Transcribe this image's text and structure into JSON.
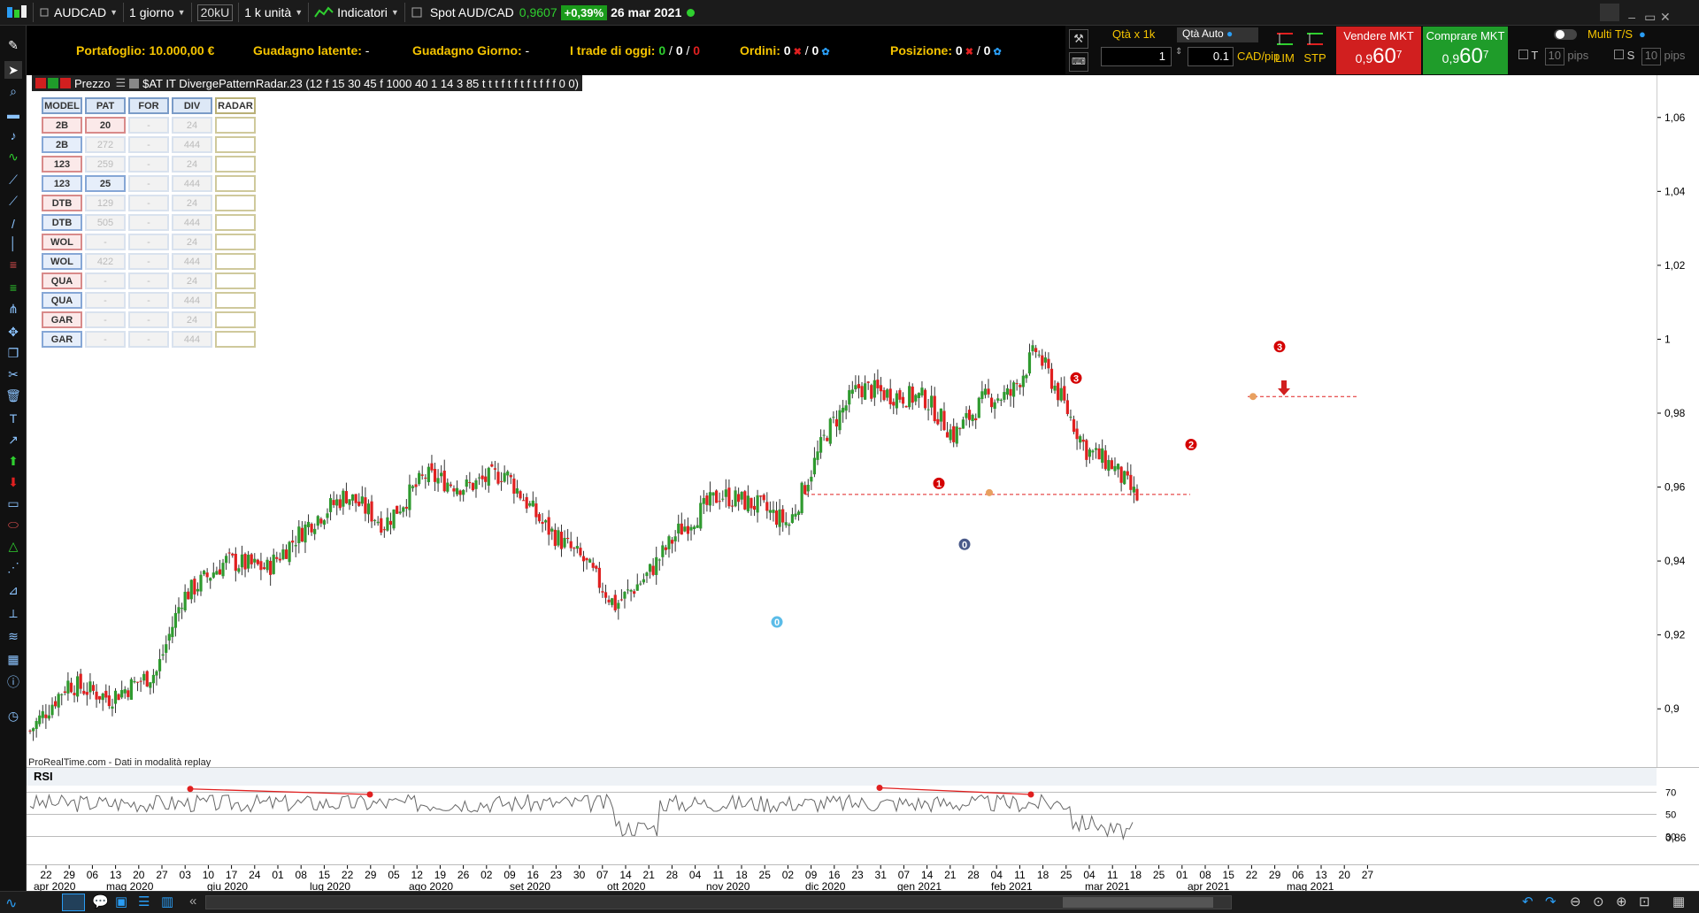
{
  "topbar": {
    "symbol": "AUDCAD",
    "timeframe": "1 giorno",
    "units_box": "20kU",
    "units": "1 k unità",
    "indicators": "Indicatori",
    "instrument": "Spot AUD/CAD",
    "last_price": "0,9607",
    "change": "+0,39%",
    "date": "26 mar 2021"
  },
  "infobar": {
    "portfolio_label": "Portafoglio:",
    "portfolio_value": "10.000,00 €",
    "latent_label": "Guadagno latente:",
    "latent_value": "-",
    "day_label": "Guadagno Giorno:",
    "day_value": "-",
    "trades_label": "I trade di oggi:",
    "trades_a": "0",
    "trades_b": "0",
    "trades_c": "0",
    "orders_label": "Ordini:",
    "orders_a": "0",
    "orders_b": "0",
    "position_label": "Posizione:",
    "position_a": "0",
    "position_b": "0"
  },
  "trade": {
    "qty_label": "Qtà  x 1k",
    "qty_auto": "Qtà Auto",
    "qty_value": "1",
    "pip_value": "0.1",
    "pip_unit": "CAD/pip",
    "lim": "LIM",
    "stp": "STP",
    "sell_label": "Vendere MKT",
    "sell_price_small": "0,9",
    "sell_price_big": "60",
    "sell_price_sup": "7",
    "buy_label": "Comprare MKT",
    "buy_price_small": "0,9",
    "buy_price_big": "60",
    "buy_price_sup": "7",
    "multi_ts": "Multi T/S",
    "t_label": "T",
    "t_value": "10",
    "s_label": "S",
    "s_value": "10",
    "pips": "pips"
  },
  "chart": {
    "price_label": "Prezzo",
    "indicator_label": "$AT IT DivergePatternRadar.23 (12 f 15 30 45 f 1000 40 1 14 3 85 t t t f t f t f t f f f 0 0)",
    "watermark": "ProRealTime.com - Dati in modalità replay",
    "rsi_label": "RSI",
    "rsi_levels": [
      "70",
      "50",
      "30"
    ],
    "price_ticks": [
      "1,06",
      "1,04",
      "1,02",
      "1",
      "0,98",
      "0,96",
      "0,94",
      "0,92",
      "0,9",
      "0,86"
    ],
    "pattern_labels": [
      {
        "text": "0",
        "color": "#5bbce8"
      },
      {
        "text": "1",
        "color": "#d40000"
      },
      {
        "text": "0",
        "color": "#4a5a8a"
      },
      {
        "text": "3",
        "color": "#d40000"
      },
      {
        "text": "2",
        "color": "#d40000"
      },
      {
        "text": "3",
        "color": "#d40000"
      }
    ]
  },
  "radar": {
    "headers": [
      "MODEL",
      "PAT",
      "FOR",
      "DIV",
      "RADAR"
    ],
    "rows": [
      {
        "model": "2B",
        "pat": "20",
        "for": "-",
        "div": "24",
        "kind": "r",
        "pat_active": true
      },
      {
        "model": "2B",
        "pat": "272",
        "for": "-",
        "div": "444",
        "kind": "b",
        "pat_active": false
      },
      {
        "model": "123",
        "pat": "259",
        "for": "-",
        "div": "24",
        "kind": "r",
        "pat_active": false
      },
      {
        "model": "123",
        "pat": "25",
        "for": "-",
        "div": "444",
        "kind": "b",
        "pat_active": true
      },
      {
        "model": "DTB",
        "pat": "129",
        "for": "-",
        "div": "24",
        "kind": "r",
        "pat_active": false
      },
      {
        "model": "DTB",
        "pat": "505",
        "for": "-",
        "div": "444",
        "kind": "b",
        "pat_active": false
      },
      {
        "model": "WOL",
        "pat": "-",
        "for": "-",
        "div": "24",
        "kind": "r",
        "pat_active": false
      },
      {
        "model": "WOL",
        "pat": "422",
        "for": "-",
        "div": "444",
        "kind": "b",
        "pat_active": false
      },
      {
        "model": "QUA",
        "pat": "-",
        "for": "-",
        "div": "24",
        "kind": "r",
        "pat_active": false
      },
      {
        "model": "QUA",
        "pat": "-",
        "for": "-",
        "div": "444",
        "kind": "b",
        "pat_active": false
      },
      {
        "model": "GAR",
        "pat": "-",
        "for": "-",
        "div": "24",
        "kind": "r",
        "pat_active": false
      },
      {
        "model": "GAR",
        "pat": "-",
        "for": "-",
        "div": "444",
        "kind": "b",
        "pat_active": false
      }
    ]
  },
  "timeaxis": {
    "days": [
      "22",
      "29",
      "06",
      "13",
      "20",
      "27",
      "03",
      "10",
      "17",
      "24",
      "01",
      "08",
      "15",
      "22",
      "29",
      "05",
      "12",
      "19",
      "26",
      "02",
      "09",
      "16",
      "23",
      "30",
      "07",
      "14",
      "21",
      "28",
      "04",
      "11",
      "18",
      "25",
      "02",
      "09",
      "16",
      "23",
      "31",
      "07",
      "14",
      "21",
      "28",
      "04",
      "11",
      "18",
      "25",
      "04",
      "11",
      "18",
      "25",
      "01",
      "08",
      "15",
      "22",
      "29",
      "06",
      "13",
      "20",
      "27"
    ],
    "months": [
      "apr 2020",
      "mag 2020",
      "giu 2020",
      "lug 2020",
      "ago 2020",
      "set 2020",
      "ott 2020",
      "nov 2020",
      "dic 2020",
      "gen 2021",
      "feb 2021",
      "mar 2021",
      "apr 2021",
      "mag 2021"
    ]
  },
  "colors": {
    "bull": "#2f9a2f",
    "bear": "#e02020",
    "accent": "#f5c400",
    "sell": "#d11f1f",
    "buy": "#1f9c2a"
  }
}
